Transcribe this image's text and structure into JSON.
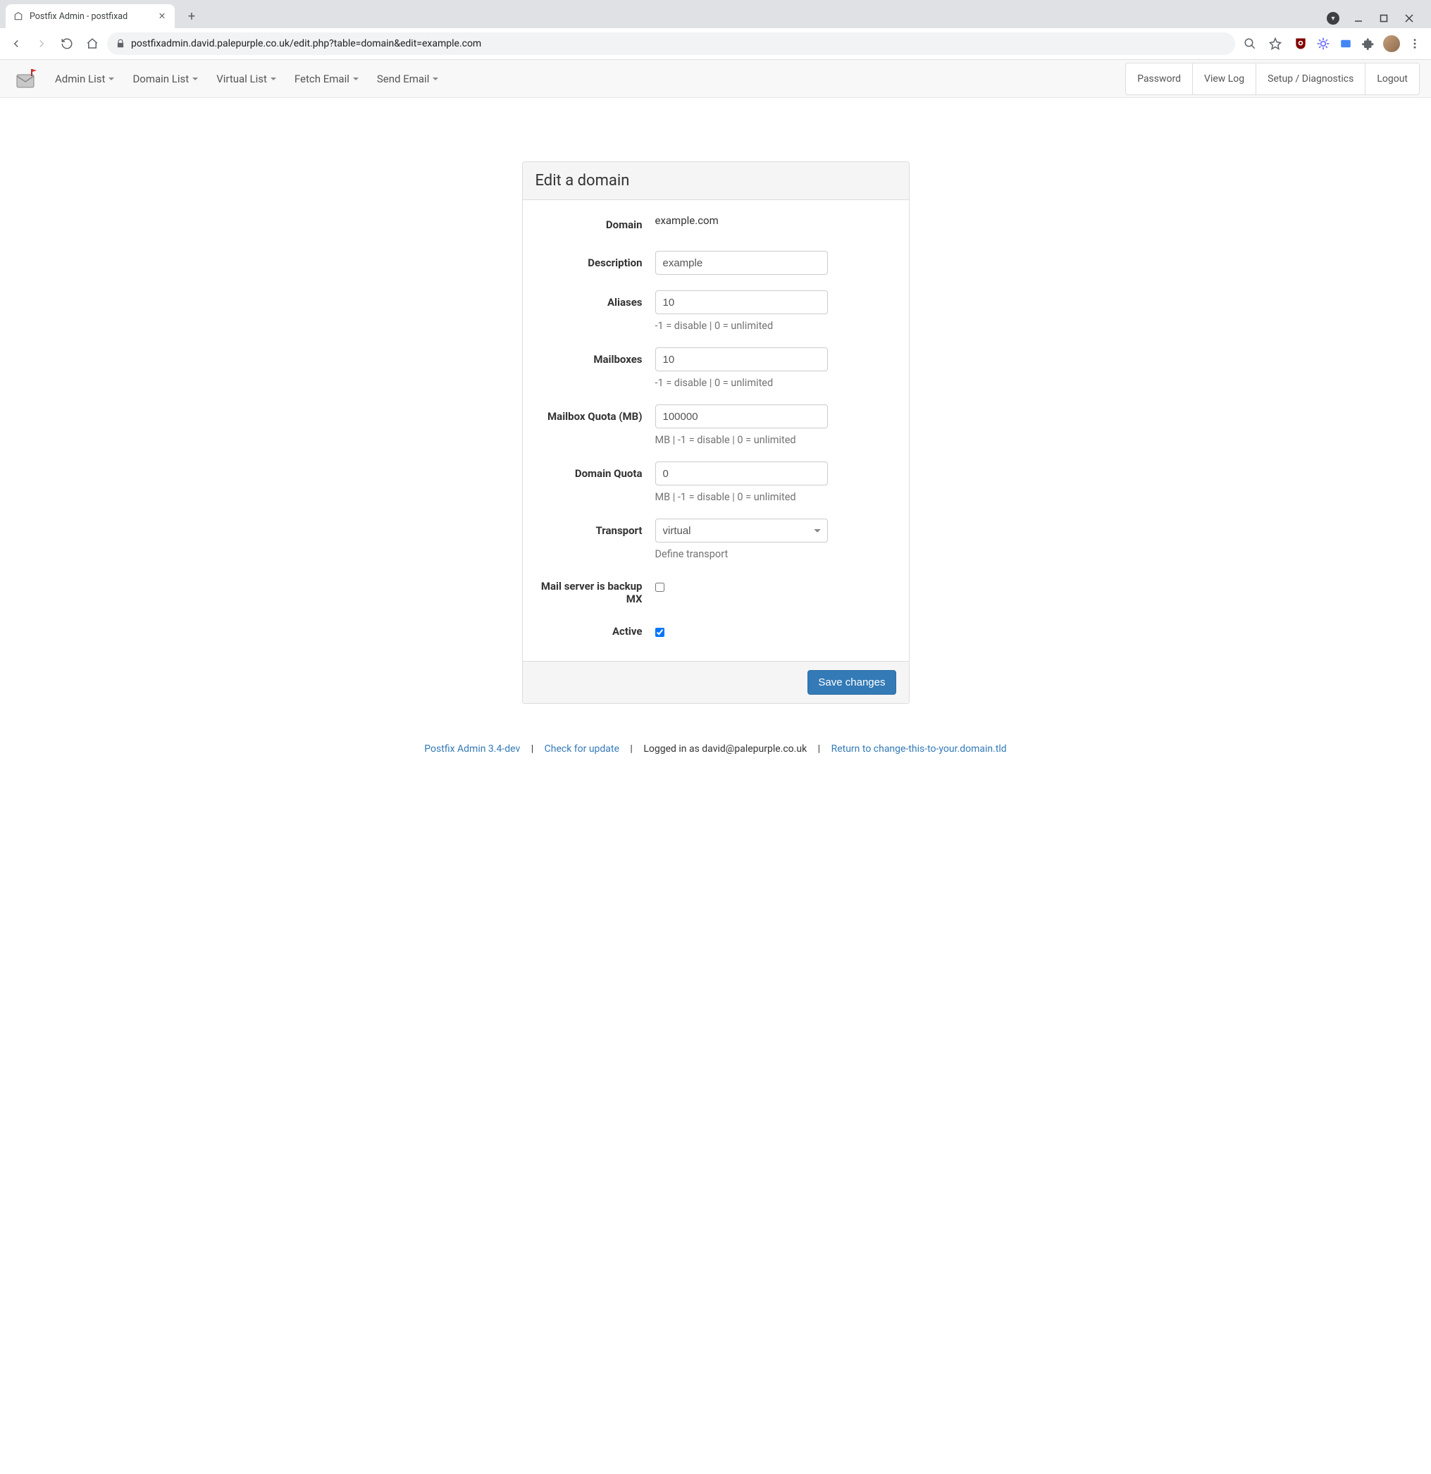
{
  "browser": {
    "tab_title": "Postfix Admin - postfixad",
    "url": "postfixadmin.david.palepurple.co.uk/edit.php?table=domain&edit=example.com"
  },
  "nav": {
    "items": [
      "Admin List",
      "Domain List",
      "Virtual List",
      "Fetch Email",
      "Send Email"
    ],
    "right": [
      "Password",
      "View Log",
      "Setup / Diagnostics",
      "Logout"
    ]
  },
  "panel": {
    "title": "Edit a domain",
    "fields": {
      "domain": {
        "label": "Domain",
        "value": "example.com"
      },
      "description": {
        "label": "Description",
        "value": "example"
      },
      "aliases": {
        "label": "Aliases",
        "value": "10",
        "help": "-1 = disable | 0 = unlimited"
      },
      "mailboxes": {
        "label": "Mailboxes",
        "value": "10",
        "help": "-1 = disable | 0 = unlimited"
      },
      "mailbox_quota": {
        "label": "Mailbox Quota (MB)",
        "value": "100000",
        "help": "MB | -1 = disable | 0 = unlimited"
      },
      "domain_quota": {
        "label": "Domain Quota",
        "value": "0",
        "help": "MB | -1 = disable | 0 = unlimited"
      },
      "transport": {
        "label": "Transport",
        "value": "virtual",
        "help": "Define transport"
      },
      "backup_mx": {
        "label": "Mail server is backup MX",
        "checked": false
      },
      "active": {
        "label": "Active",
        "checked": true
      }
    },
    "submit": "Save changes"
  },
  "footer": {
    "product": "Postfix Admin 3.4-dev",
    "check_update": "Check for update",
    "logged_in": "Logged in as david@palepurple.co.uk",
    "return_link": "Return to change-this-to-your.domain.tld"
  }
}
